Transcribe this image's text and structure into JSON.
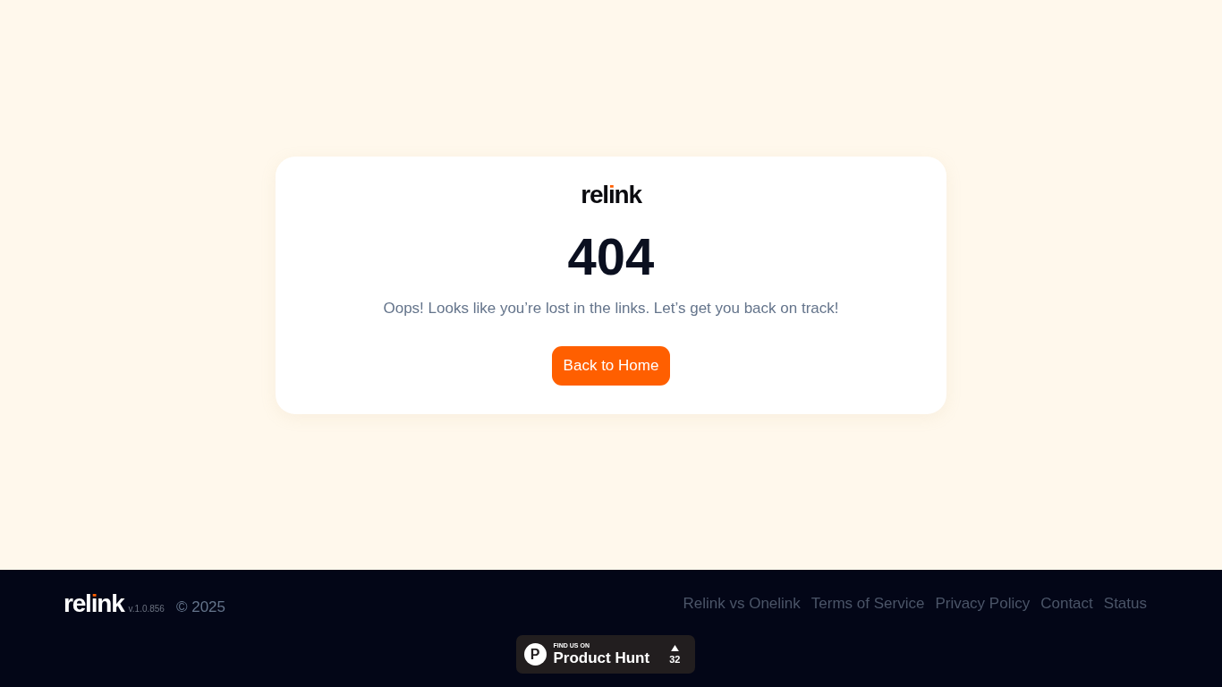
{
  "card": {
    "logo": "relink",
    "code": "404",
    "message": "Oops! Looks like you’re lost in the links. Let’s get you back on track!",
    "button": "Back to Home"
  },
  "footer": {
    "logo": "relink",
    "version": "v.1.0.856",
    "copyright": "© 2025",
    "links": [
      "Relink vs Onelink",
      "Terms of Service",
      "Privacy Policy",
      "Contact",
      "Status"
    ],
    "badge": {
      "mark": "P",
      "kicker": "FIND US ON",
      "name": "Product Hunt",
      "votes": "32"
    }
  }
}
